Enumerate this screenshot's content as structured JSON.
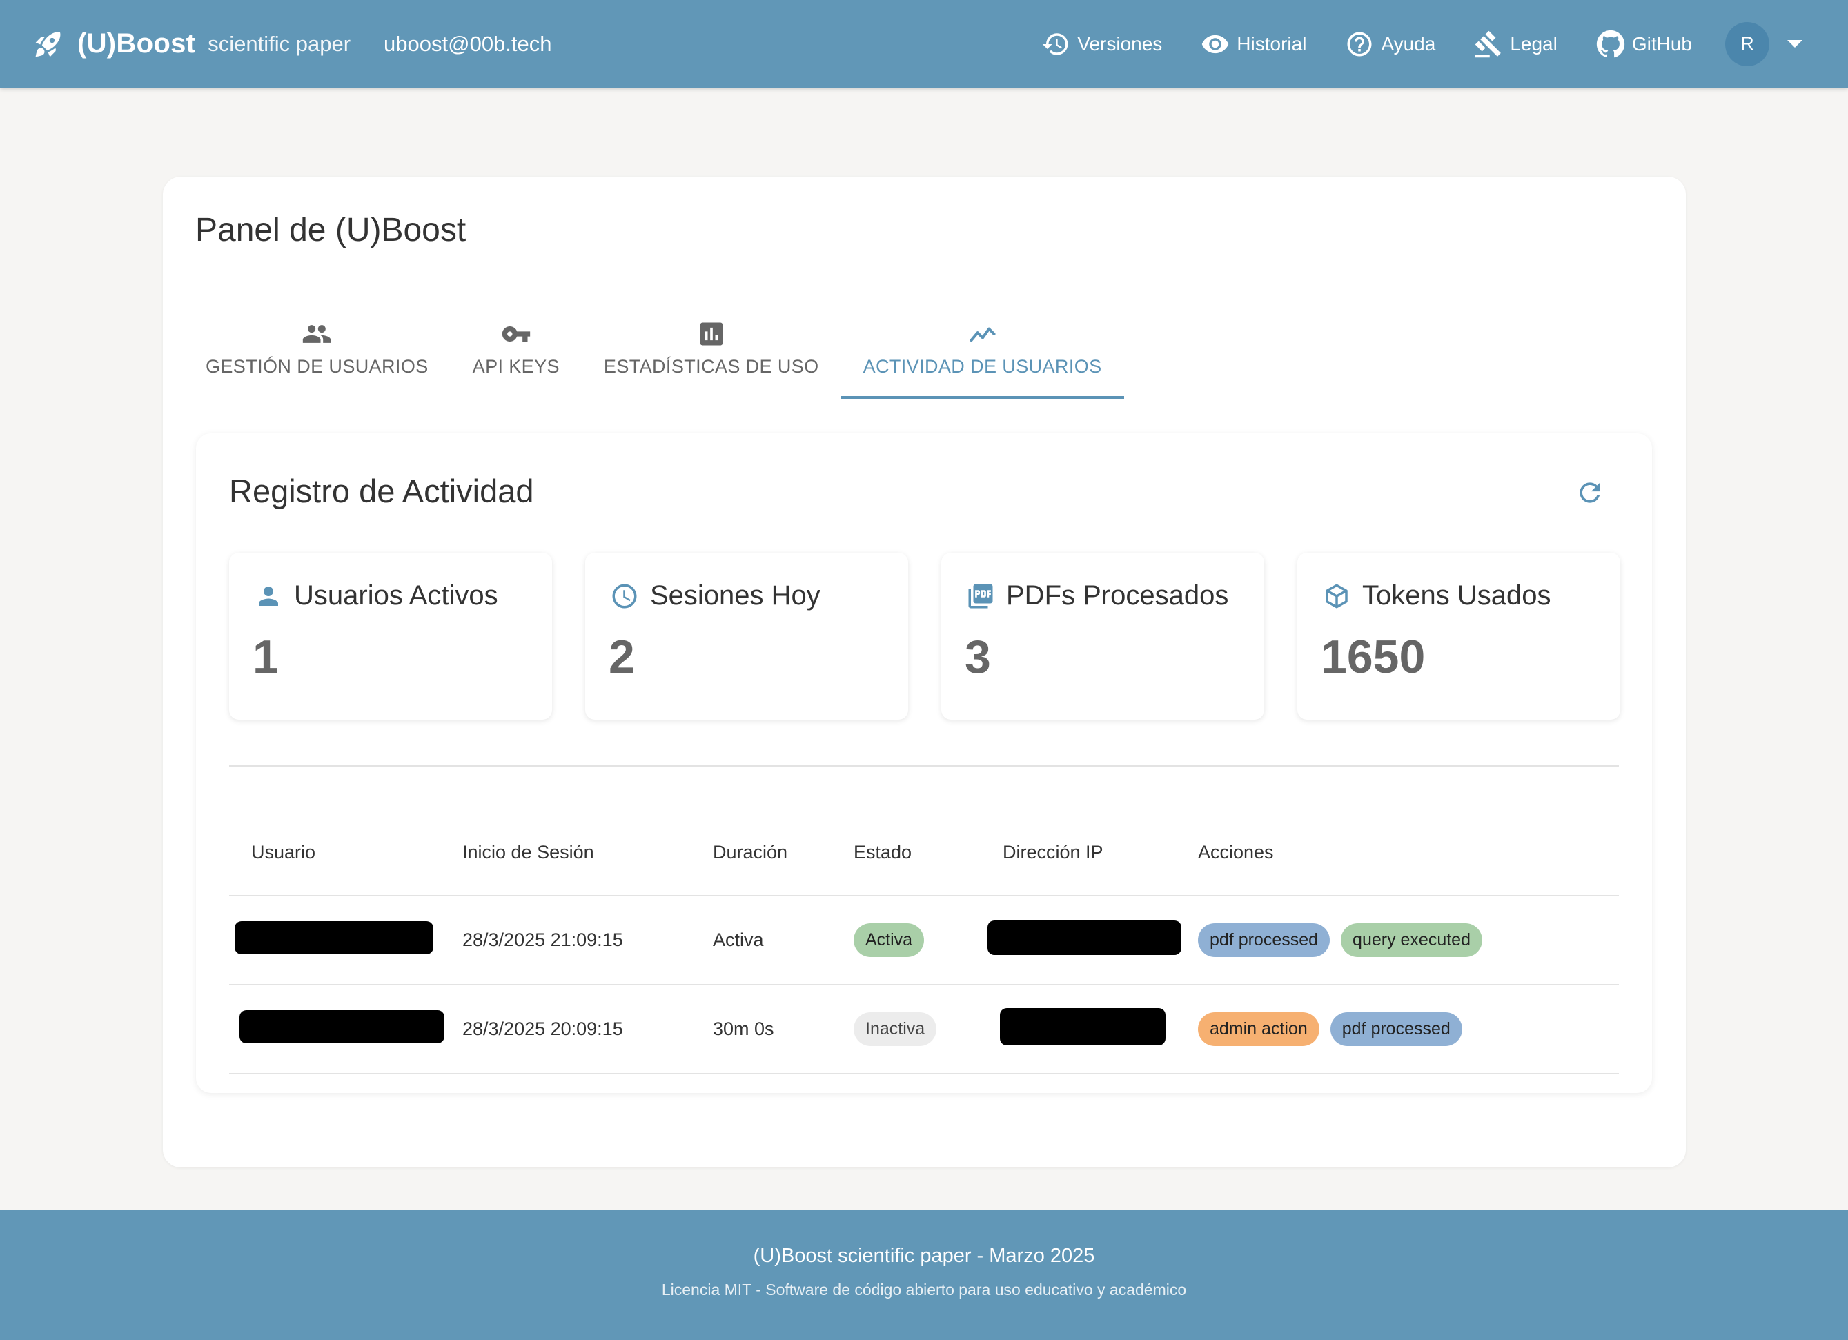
{
  "header": {
    "brand_name": "(U)Boost",
    "brand_sub": "scientific paper",
    "email": "uboost@00b.tech",
    "nav": [
      {
        "label": "Versiones",
        "icon": "history-icon"
      },
      {
        "label": "Historial",
        "icon": "eye-icon"
      },
      {
        "label": "Ayuda",
        "icon": "help-icon"
      },
      {
        "label": "Legal",
        "icon": "gavel-icon"
      },
      {
        "label": "GitHub",
        "icon": "github-icon"
      }
    ],
    "avatar": "R"
  },
  "page": {
    "title": "Panel de (U)Boost",
    "tabs": [
      {
        "label": "GESTIÓN DE USUARIOS",
        "icon": "people-icon",
        "active": false
      },
      {
        "label": "API KEYS",
        "icon": "key-icon",
        "active": false
      },
      {
        "label": "ESTADÍSTICAS DE USO",
        "icon": "bar-chart-icon",
        "active": false
      },
      {
        "label": "ACTIVIDAD DE USUARIOS",
        "icon": "timeline-icon",
        "active": true
      }
    ]
  },
  "activity": {
    "title": "Registro de Actividad",
    "stats": [
      {
        "label": "Usuarios Activos",
        "value": "1",
        "icon": "person-icon"
      },
      {
        "label": "Sesiones Hoy",
        "value": "2",
        "icon": "clock-icon"
      },
      {
        "label": "PDFs Procesados",
        "value": "3",
        "icon": "pdf-icon"
      },
      {
        "label": "Tokens Usados",
        "value": "1650",
        "icon": "token-icon"
      }
    ],
    "columns": [
      "Usuario",
      "Inicio de Sesión",
      "Duración",
      "Estado",
      "Dirección IP",
      "Acciones"
    ],
    "rows": [
      {
        "login": "28/3/2025 21:09:15",
        "duration": "Activa",
        "status": "Activa",
        "actions": [
          "pdf processed",
          "query executed"
        ]
      },
      {
        "login": "28/3/2025 20:09:15",
        "duration": "30m 0s",
        "status": "Inactiva",
        "actions": [
          "admin action",
          "pdf processed"
        ]
      }
    ]
  },
  "footer": {
    "line1": "(U)Boost scientific paper - Marzo 2025",
    "line2": "Licencia MIT - Software de código abierto para uso educativo y académico"
  },
  "colors": {
    "primary": "#6197b7",
    "accent": "#5b93b6",
    "active_chip": "#a9cfa8",
    "inactive_chip": "#ececec",
    "pdf_chip": "#8fb0d4",
    "admin_chip": "#f6b071"
  }
}
